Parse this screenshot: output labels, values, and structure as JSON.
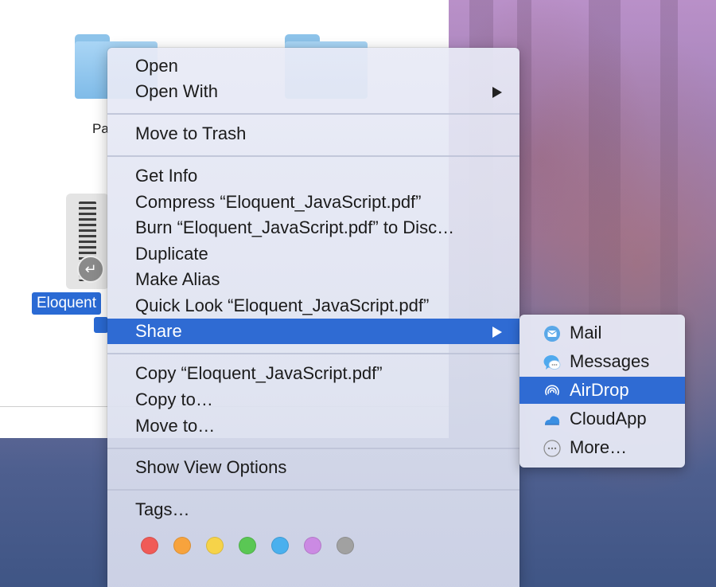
{
  "finder": {
    "folder_label_partial": "Pa",
    "selected_file_label": "Eloquent"
  },
  "context_menu": {
    "items": [
      {
        "label": "Open"
      },
      {
        "label": "Open With",
        "has_submenu": true
      },
      {
        "label": "Move to Trash"
      },
      {
        "label": "Get Info"
      },
      {
        "label": "Compress “Eloquent_JavaScript.pdf”"
      },
      {
        "label": "Burn “Eloquent_JavaScript.pdf” to Disc…"
      },
      {
        "label": "Duplicate"
      },
      {
        "label": "Make Alias"
      },
      {
        "label": "Quick Look “Eloquent_JavaScript.pdf”"
      },
      {
        "label": "Share",
        "has_submenu": true,
        "highlighted": true
      },
      {
        "label": "Copy “Eloquent_JavaScript.pdf”"
      },
      {
        "label": "Copy to…"
      },
      {
        "label": "Move to…"
      },
      {
        "label": "Show View Options"
      },
      {
        "label": "Tags…"
      }
    ],
    "tag_colors": [
      {
        "name": "red",
        "color": "#f05b57"
      },
      {
        "name": "orange",
        "color": "#f7a33d"
      },
      {
        "name": "yellow",
        "color": "#f6d349"
      },
      {
        "name": "green",
        "color": "#5ac754"
      },
      {
        "name": "blue",
        "color": "#4ab0ee"
      },
      {
        "name": "purple",
        "color": "#cb8ae3"
      },
      {
        "name": "gray",
        "color": "#a1a1a1"
      }
    ]
  },
  "share_submenu": {
    "items": [
      {
        "label": "Mail",
        "icon": "mail-icon"
      },
      {
        "label": "Messages",
        "icon": "messages-icon"
      },
      {
        "label": "AirDrop",
        "icon": "airdrop-icon",
        "highlighted": true
      },
      {
        "label": "CloudApp",
        "icon": "cloudapp-icon"
      },
      {
        "label": "More…",
        "icon": "more-icon"
      }
    ]
  },
  "colors": {
    "highlight": "#2f6bd3"
  }
}
